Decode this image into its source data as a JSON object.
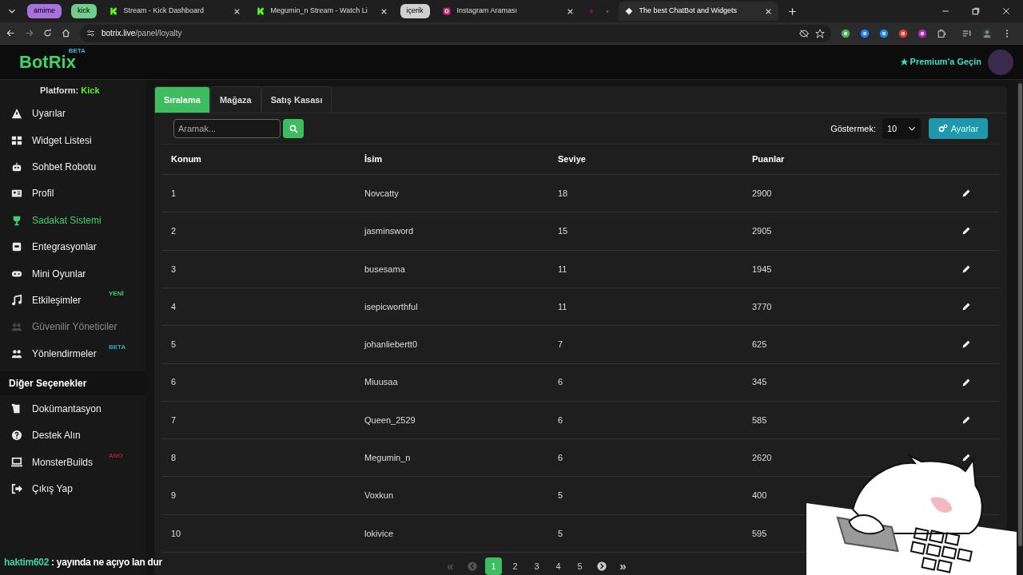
{
  "browser": {
    "tabs": [
      {
        "kind": "group",
        "label": "amime",
        "color": "#a970e0"
      },
      {
        "kind": "group",
        "label": "kick",
        "color": "#6fcf8a"
      },
      {
        "kind": "tab",
        "label": "Stream - Kick Dashboard",
        "selected": false
      },
      {
        "kind": "tab",
        "label": "Megumin_n Stream - Watch Li",
        "selected": false
      },
      {
        "kind": "group",
        "label": "içerik",
        "color": "#d0d0d0"
      },
      {
        "kind": "tab",
        "label": "Instagram Araması",
        "selected": false
      },
      {
        "kind": "tab",
        "selected": false
      },
      {
        "kind": "tab",
        "label": "The best ChatBot and Widgets",
        "selected": true
      }
    ],
    "url_host": "botrix.live",
    "url_path": "/panel/loyalty"
  },
  "header": {
    "logo": "BotRix",
    "logo_badge": "BETA",
    "premium": "Premium'a Geçin"
  },
  "sidebar": {
    "platform_label": "Platform:",
    "platform": "Kick",
    "items": [
      {
        "label": "Uyarılar",
        "selected": false,
        "disabled": false
      },
      {
        "label": "Widget Listesi",
        "selected": false,
        "disabled": false
      },
      {
        "label": "Sohbet Robotu",
        "selected": false,
        "disabled": false
      },
      {
        "label": "Profil",
        "selected": false,
        "disabled": false
      },
      {
        "label": "Sadakat Sistemi",
        "selected": true,
        "disabled": false
      },
      {
        "label": "Entegrasyonlar",
        "selected": false,
        "disabled": false
      },
      {
        "label": "Mini Oyunlar",
        "selected": false,
        "disabled": false
      },
      {
        "label": "Etkileşimler",
        "selected": false,
        "disabled": false,
        "badge": "YENİ",
        "color": "#3ecf6a"
      },
      {
        "label": "Güvenilir Yöneticiler",
        "selected": false,
        "disabled": true
      },
      {
        "label": "Yönlendirmeler",
        "selected": false,
        "disabled": false,
        "badge": "BETA",
        "color": "#2fa5b0"
      }
    ],
    "section_title": "Diğer Seçenekler",
    "other_items": [
      {
        "label": "Dokümantasyon",
        "selected": false,
        "disabled": false
      },
      {
        "label": "Destek Alın",
        "selected": false,
        "disabled": false
      },
      {
        "label": "MonsterBuilds",
        "selected": false,
        "disabled": false,
        "badge": "ANO",
        "color": "#a3203a"
      },
      {
        "label": "Çıkış Yap",
        "selected": false,
        "disabled": false
      }
    ]
  },
  "chat_overlay": {
    "user": "haktim602",
    "message": ": yayında ne açıyo lan dur"
  },
  "tabs": [
    {
      "label": "Sıralama",
      "selected": true
    },
    {
      "label": "Mağaza",
      "selected": false
    },
    {
      "label": "Satış Kasası",
      "selected": false
    }
  ],
  "search": {
    "placeholder": "Aramak..."
  },
  "show": {
    "label": "Göstermek:",
    "value": "10"
  },
  "settings_button": "Ayarlar",
  "table": {
    "columns": [
      "Konum",
      "İsim",
      "Seviye",
      "Puanlar"
    ],
    "rows": [
      {
        "kind": "editable",
        "cells": [
          "1",
          "Novcatty",
          "18",
          "2900"
        ]
      },
      {
        "kind": "editable",
        "cells": [
          "2",
          "jasminsword",
          "15",
          "2905"
        ]
      },
      {
        "kind": "editable",
        "cells": [
          "3",
          "busesama",
          "11",
          "1945"
        ]
      },
      {
        "kind": "editable",
        "cells": [
          "4",
          "isepicworthful",
          "11",
          "3770"
        ]
      },
      {
        "kind": "editable",
        "cells": [
          "5",
          "johanliebertt0",
          "7",
          "625"
        ]
      },
      {
        "kind": "editable",
        "cells": [
          "6",
          "Miuusaa",
          "6",
          "345"
        ]
      },
      {
        "kind": "editable",
        "cells": [
          "7",
          "Queen_2529",
          "6",
          "585"
        ]
      },
      {
        "kind": "editable",
        "cells": [
          "8",
          "Megumin_n",
          "6",
          "2620"
        ]
      },
      {
        "kind": "plain",
        "cells": [
          "9",
          "Voxkun",
          "5",
          "400"
        ]
      },
      {
        "kind": "plain",
        "cells": [
          "10",
          "lokivice",
          "5",
          "595"
        ]
      }
    ]
  },
  "pagination": [
    {
      "kind": "first",
      "label": "«",
      "disabled": true,
      "selected": false
    },
    {
      "kind": "prev",
      "disabled": true,
      "selected": false
    },
    {
      "kind": "page",
      "label": "1",
      "selected": true,
      "disabled": false
    },
    {
      "kind": "page",
      "label": "2",
      "selected": false,
      "disabled": false
    },
    {
      "kind": "page",
      "label": "3",
      "selected": false,
      "disabled": false
    },
    {
      "kind": "page",
      "label": "4",
      "selected": false,
      "disabled": false
    },
    {
      "kind": "page",
      "label": "5",
      "selected": false,
      "disabled": false
    },
    {
      "kind": "next",
      "disabled": false,
      "selected": false
    },
    {
      "kind": "last",
      "label": "»",
      "disabled": false,
      "selected": false
    }
  ]
}
